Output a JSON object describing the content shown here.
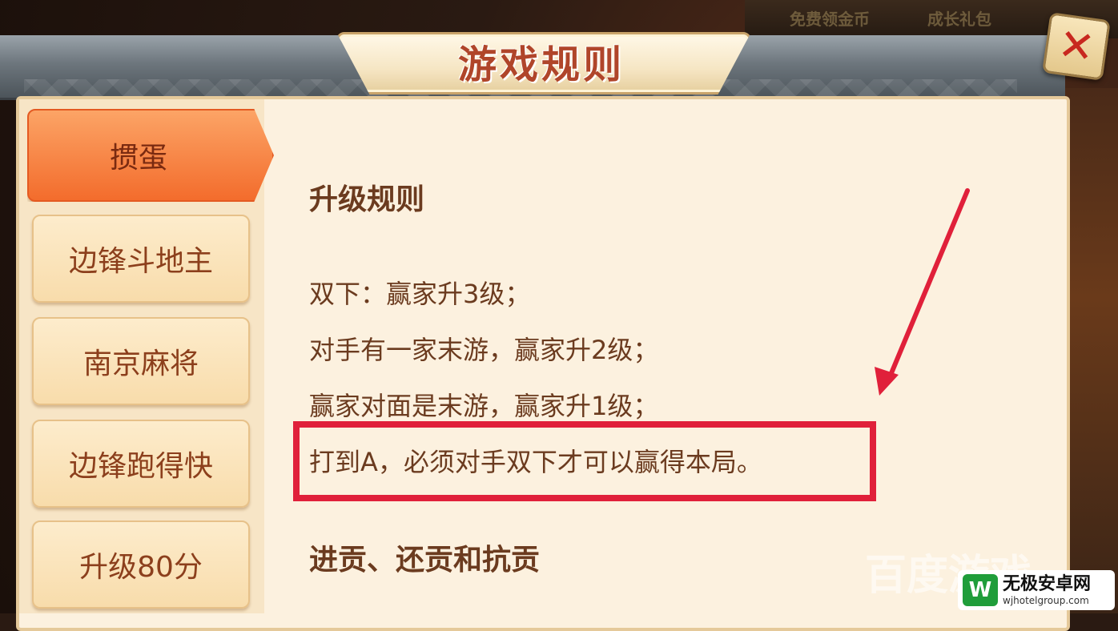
{
  "background": {
    "top_texts": [
      "免费领金币",
      "成长礼包"
    ]
  },
  "header": {
    "title": "游戏规则",
    "close_icon": "close-x-icon"
  },
  "sidebar": {
    "tabs": [
      {
        "label": "掼蛋",
        "active": true
      },
      {
        "label": "边锋斗地主",
        "active": false
      },
      {
        "label": "南京麻将",
        "active": false
      },
      {
        "label": "边锋跑得快",
        "active": false
      },
      {
        "label": "升级80分",
        "active": false
      }
    ]
  },
  "content": {
    "section1_title": "升级规则",
    "rules": [
      "双下：赢家升3级；",
      "对手有一家末游，赢家升2级；",
      "赢家对面是末游，赢家升1级；",
      "打到A，必须对手双下才可以赢得本局。"
    ],
    "section2_title": "进贡、还贡和抗贡"
  },
  "annotation": {
    "highlight_color": "#e0203a",
    "arrow_color": "#e0203a"
  },
  "watermark": {
    "baidu_text": "百度游戏",
    "site_name": "无极安卓网",
    "site_url": "wjhotelgroup.com",
    "logo_letter": "W"
  }
}
